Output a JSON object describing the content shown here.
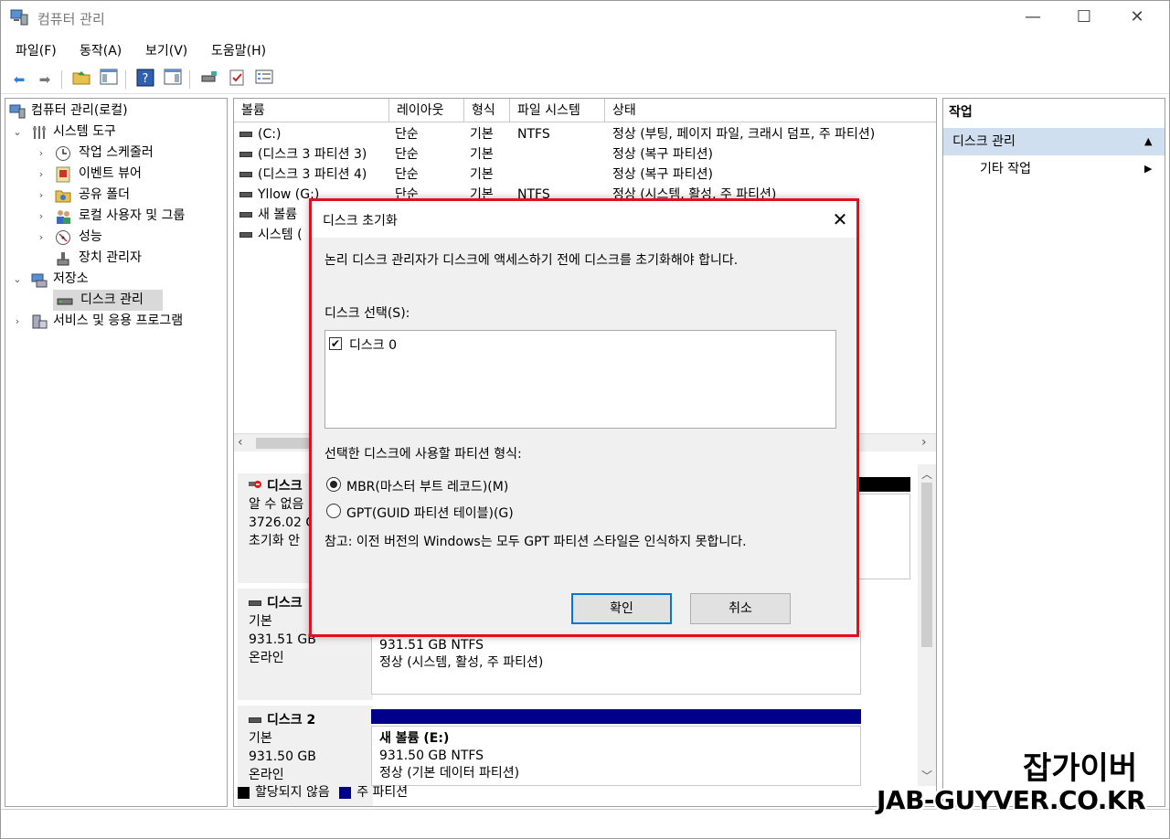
{
  "window": {
    "title": "컴퓨터 관리",
    "min_label": "—",
    "max_label": "☐",
    "close_label": "✕"
  },
  "menu": [
    "파일(F)",
    "동작(A)",
    "보기(V)",
    "도움말(H)"
  ],
  "tree": {
    "root": "컴퓨터 관리(로컬)",
    "system_tools": "시스템 도구",
    "task_scheduler": "작업 스케줄러",
    "event_viewer": "이벤트 뷰어",
    "shared_folders": "공유 폴더",
    "local_users": "로컬 사용자 및 그룹",
    "performance": "성능",
    "device_manager": "장치 관리자",
    "storage": "저장소",
    "disk_management": "디스크 관리",
    "services": "서비스 및 응용 프로그램"
  },
  "table": {
    "headers": [
      "볼륨",
      "레이아웃",
      "형식",
      "파일 시스템",
      "상태"
    ],
    "rows": [
      [
        "(C:)",
        "단순",
        "기본",
        "NTFS",
        "정상 (부팅, 페이지 파일, 크래시 덤프, 주 파티션)"
      ],
      [
        "(디스크 3 파티션 3)",
        "단순",
        "기본",
        "",
        "정상 (복구 파티션)"
      ],
      [
        "(디스크 3 파티션 4)",
        "단순",
        "기본",
        "",
        "정상 (복구 파티션)"
      ],
      [
        "Yllow (G:)",
        "단순",
        "기본",
        "NTFS",
        "정상 (시스템, 활성, 주 파티션)"
      ],
      [
        "새 볼륨",
        "",
        "",
        "",
        ""
      ],
      [
        "시스템 (",
        "",
        "",
        "",
        ""
      ]
    ]
  },
  "disks": {
    "d0_name": "디스크",
    "d0_l1": "알 수 없음",
    "d0_l2": "3726.02 G",
    "d0_l3": "초기화 안",
    "d1_name": "디스크",
    "d1_l1": "기본",
    "d1_l2": "931.51 GB",
    "d1_l3": "온라인",
    "d1_part_l1": "931.51 GB NTFS",
    "d1_part_l2": "정상 (시스템, 활성, 주 파티션)",
    "d2_name": "디스크 2",
    "d2_l1": "기본",
    "d2_l2": "931.50 GB",
    "d2_l3": "온라인",
    "d2_part_name": "새 볼륨  (E:)",
    "d2_part_l1": "931.50 GB NTFS",
    "d2_part_l2": "정상 (기본 데이터 파티션)"
  },
  "legend": {
    "unallocated": "할당되지 않음",
    "primary": "주 파티션",
    "unallocated_color": "#000000",
    "primary_color": "#00008b"
  },
  "actions": {
    "header": "작업",
    "group": "디스크 관리",
    "other": "기타 작업"
  },
  "dialog": {
    "title": "디스크 초기화",
    "message": "논리 디스크 관리자가 디스크에 액세스하기 전에 디스크를 초기화해야 합니다.",
    "select_label": "디스크 선택(S):",
    "disk_item": "디스크 0",
    "partition_label": "선택한 디스크에 사용할 파티션 형식:",
    "mbr": "MBR(마스터 부트 레코드)(M)",
    "gpt": "GPT(GUID 파티션 테이블)(G)",
    "note": "참고: 이전 버전의 Windows는 모두 GPT 파티션 스타일은 인식하지 못합니다.",
    "ok": "확인",
    "cancel": "취소",
    "highlight_color": "#e0101e"
  },
  "watermark": {
    "line1": "잡가이버",
    "line2": "JAB-GUYVER.CO.KR"
  }
}
